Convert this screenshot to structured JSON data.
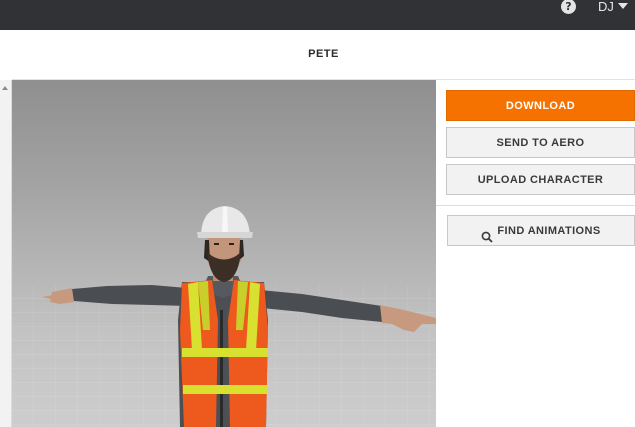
{
  "header": {
    "help_icon_glyph": "?",
    "user_initials": "DJ"
  },
  "page": {
    "title": "PETE"
  },
  "sidebar": {
    "download_label": "DOWNLOAD",
    "send_to_aero_label": "SEND TO AERO",
    "upload_character_label": "UPLOAD CHARACTER",
    "find_animations_label": "FIND ANIMATIONS"
  },
  "colors": {
    "topbar_bg": "#303236",
    "accent_orange": "#f57200",
    "viewport_bg": "#a6a6a6"
  },
  "icons": [
    "help-icon",
    "chevron-down-icon",
    "scroll-up-icon",
    "search-icon"
  ]
}
